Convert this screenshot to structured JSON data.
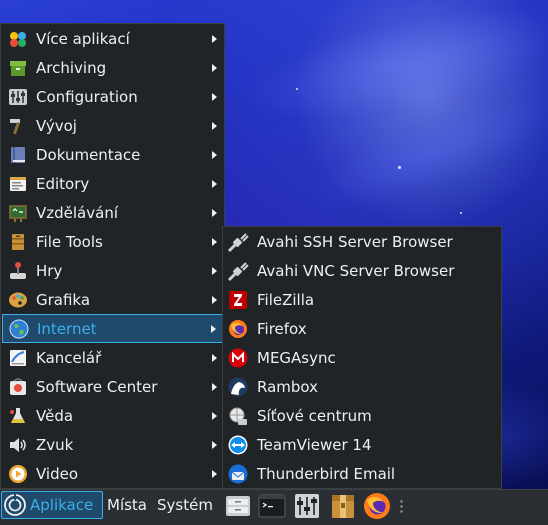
{
  "main_menu": {
    "items": [
      {
        "label": "Více aplikací",
        "icon": "more-apps-icon"
      },
      {
        "label": "Archiving",
        "icon": "archive-icon"
      },
      {
        "label": "Configuration",
        "icon": "settings-icon"
      },
      {
        "label": "Vývoj",
        "icon": "development-icon"
      },
      {
        "label": "Dokumentace",
        "icon": "documentation-icon"
      },
      {
        "label": "Editory",
        "icon": "editor-icon"
      },
      {
        "label": "Vzdělávání",
        "icon": "education-icon"
      },
      {
        "label": "File Tools",
        "icon": "file-tools-icon"
      },
      {
        "label": "Hry",
        "icon": "games-icon"
      },
      {
        "label": "Grafika",
        "icon": "graphics-icon"
      },
      {
        "label": "Internet",
        "icon": "internet-icon",
        "active": true
      },
      {
        "label": "Kancelář",
        "icon": "office-icon"
      },
      {
        "label": "Software Center",
        "icon": "software-center-icon"
      },
      {
        "label": "Věda",
        "icon": "science-icon"
      },
      {
        "label": "Zvuk",
        "icon": "sound-icon"
      },
      {
        "label": "Video",
        "icon": "video-icon"
      }
    ]
  },
  "internet_submenu": {
    "items": [
      {
        "label": "Avahi SSH Server Browser",
        "icon": "avahi-ssh-icon"
      },
      {
        "label": "Avahi VNC Server Browser",
        "icon": "avahi-vnc-icon"
      },
      {
        "label": "FileZilla",
        "icon": "filezilla-icon"
      },
      {
        "label": "Firefox",
        "icon": "firefox-icon"
      },
      {
        "label": "MEGAsync",
        "icon": "megasync-icon"
      },
      {
        "label": "Rambox",
        "icon": "rambox-icon"
      },
      {
        "label": "Síťové centrum",
        "icon": "network-center-icon"
      },
      {
        "label": "TeamViewer 14",
        "icon": "teamviewer-icon"
      },
      {
        "label": "Thunderbird Email",
        "icon": "thunderbird-icon"
      }
    ]
  },
  "panel": {
    "apps_label": "Aplikace",
    "places_label": "Místa",
    "system_label": "Systém",
    "launchers": [
      "file-manager-icon",
      "terminal-icon",
      "mixer-icon",
      "archive-manager-icon",
      "firefox-icon"
    ]
  },
  "colors": {
    "menu_bg": "#202427",
    "accent": "#3daee9",
    "active_bg": "#1f4a6b",
    "text": "#eff0f1"
  }
}
